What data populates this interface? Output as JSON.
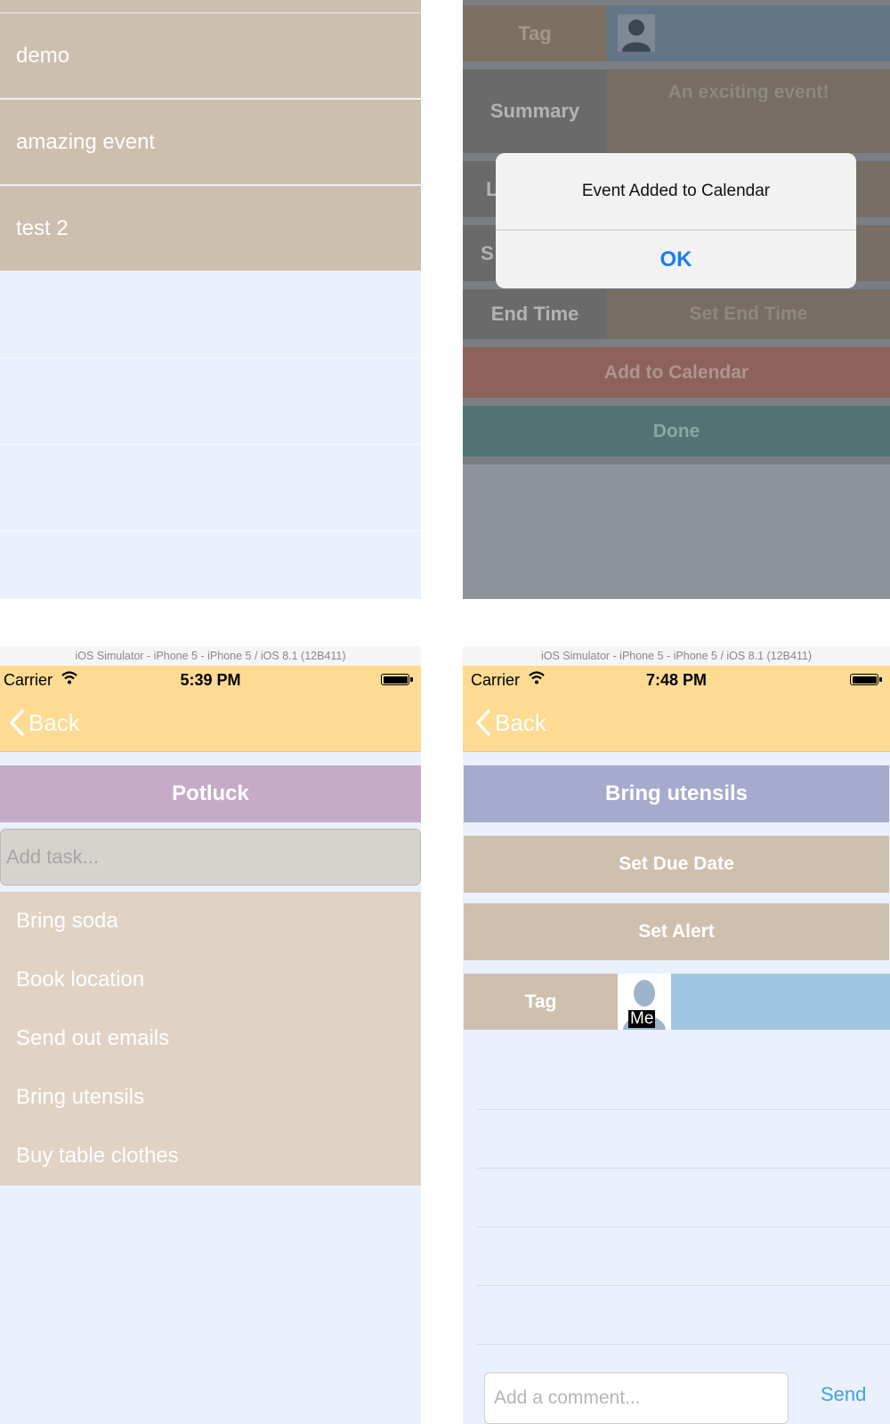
{
  "top_left": {
    "events": [
      "demo",
      "amazing event",
      "test 2"
    ]
  },
  "top_right": {
    "tag_label": "Tag",
    "summary_label": "Summary",
    "summary_placeholder": "An exciting event!",
    "location_label_partial": "L",
    "start_label_partial": "S",
    "end_time_label": "End Time",
    "end_time_value": "Set End Time",
    "add_to_calendar": "Add to Calendar",
    "done": "Done",
    "alert": {
      "message": "Event Added to Calendar",
      "ok": "OK"
    }
  },
  "bottom_left": {
    "simulator_title": "iOS Simulator - iPhone 5 - iPhone 5 / iOS 8.1 (12B411)",
    "carrier": "Carrier",
    "time": "5:39 PM",
    "back": "Back",
    "title": "Potluck",
    "add_task_placeholder": "Add task...",
    "tasks": [
      "Bring soda",
      "Book location",
      "Send out emails",
      "Bring utensils",
      "Buy table clothes"
    ]
  },
  "bottom_right": {
    "simulator_title": "iOS Simulator - iPhone 5 - iPhone 5 / iOS 8.1 (12B411)",
    "carrier": "Carrier",
    "time": "7:48 PM",
    "back": "Back",
    "title": "Bring utensils",
    "set_due_date": "Set Due Date",
    "set_alert": "Set Alert",
    "tag_label": "Tag",
    "avatar_label": "Me",
    "comment_placeholder": "Add a comment...",
    "send": "Send"
  },
  "colors": {
    "nav_yellow": "#fddb92",
    "row_tan": "#cdbfae",
    "list_bg": "#eaf1fc",
    "potluck_title": "#c6abc8",
    "utensils_title": "#a6aacc",
    "tag_blue": "#9fc6e1",
    "ios_blue": "#1a7cf0",
    "send_blue": "#3ea2e0"
  },
  "icons": [
    "wifi-icon",
    "battery-icon",
    "chevron-left-icon",
    "person-placeholder-icon"
  ]
}
